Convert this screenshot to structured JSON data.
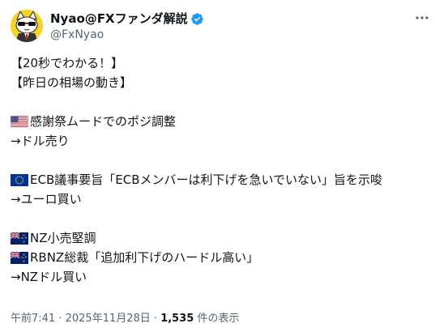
{
  "author": {
    "display_name": "Nyao@FXファンダ解説",
    "handle": "@FxNyao",
    "avatar_icon": "cat-with-sunglasses-avatar",
    "verified_icon": "verified-badge-icon",
    "verified_color": "#1d9bf0"
  },
  "more_icon": "more-options-icon",
  "tweet": {
    "lines": [
      {
        "text": "【20秒でわかる！】"
      },
      {
        "text": "【昨日の相場の動き】"
      },
      {
        "blank": true
      },
      {
        "flag": "us-flag-icon",
        "text": "感謝祭ムードでのポジ調整"
      },
      {
        "text": "→ドル売り"
      },
      {
        "blank": true
      },
      {
        "flag": "eu-flag-icon",
        "text": "ECB議事要旨「ECBメンバーは利下げを急いでいない」旨を示唆"
      },
      {
        "text": "→ユーロ買い"
      },
      {
        "blank": true
      },
      {
        "flag": "nz-flag-icon",
        "text": "NZ小売堅調"
      },
      {
        "flag": "nz-flag-icon",
        "text": "RBNZ総裁「追加利下げのハードル高い」"
      },
      {
        "text": "→NZドル買い"
      }
    ]
  },
  "meta": {
    "time": "午前7:41",
    "separator": " · ",
    "date": "2025年11月28日",
    "views_count": "1,535",
    "views_label": " 件の表示"
  },
  "colors": {
    "text": "#0f1419",
    "secondary": "#536471",
    "avatar_bg": "#f5d328"
  }
}
